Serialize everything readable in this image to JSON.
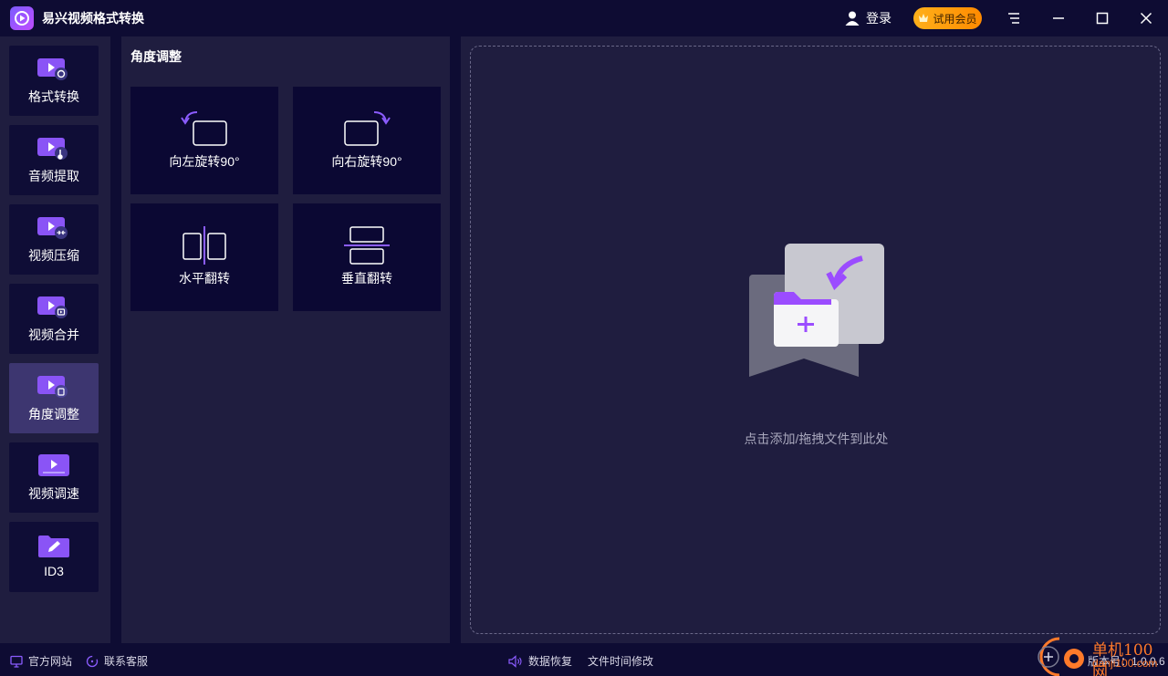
{
  "app": {
    "title": "易兴视频格式转换",
    "login_label": "登录",
    "vip_label": "试用会员"
  },
  "sidebar": {
    "items": [
      {
        "label": "格式转换",
        "icon": "video-convert-icon",
        "active": false
      },
      {
        "label": "音频提取",
        "icon": "audio-extract-icon",
        "active": false
      },
      {
        "label": "视频压缩",
        "icon": "video-compress-icon",
        "active": false
      },
      {
        "label": "视频合并",
        "icon": "video-merge-icon",
        "active": false
      },
      {
        "label": "角度调整",
        "icon": "angle-adjust-icon",
        "active": true
      },
      {
        "label": "视频调速",
        "icon": "video-speed-icon",
        "active": false
      },
      {
        "label": "ID3",
        "icon": "id3-edit-icon",
        "active": false
      }
    ]
  },
  "panel": {
    "title": "角度调整",
    "operations": [
      {
        "label": "向左旋转90°",
        "icon": "rotate-left-icon"
      },
      {
        "label": "向右旋转90°",
        "icon": "rotate-right-icon"
      },
      {
        "label": "水平翻转",
        "icon": "flip-horizontal-icon"
      },
      {
        "label": "垂直翻转",
        "icon": "flip-vertical-icon"
      }
    ]
  },
  "dropzone": {
    "text": "点击添加/拖拽文件到此处"
  },
  "statusbar": {
    "website": "官方网站",
    "support": "联系客服",
    "data_recovery": "数据恢复",
    "file_time": "文件时间修改",
    "version": "版本号：1.0.0.6"
  },
  "watermark": {
    "line1": "单机100网",
    "line2": "danji100.com"
  },
  "colors": {
    "background": "#0e0c33",
    "panel": "#1f1d3f",
    "card": "#0b0833",
    "active": "#3d3670",
    "accent": "#8b5cff",
    "vip": "#ff9d0e"
  }
}
